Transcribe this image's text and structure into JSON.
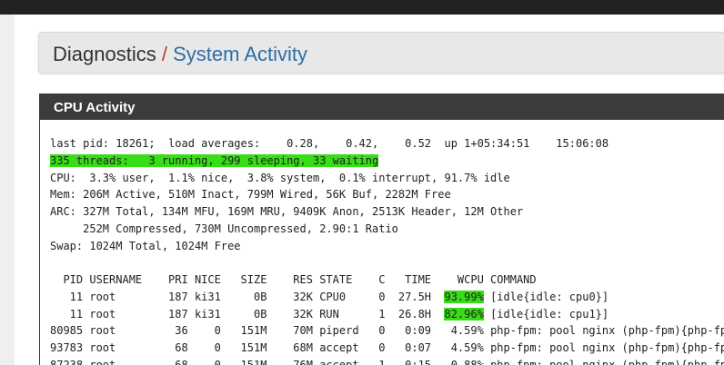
{
  "breadcrumb": {
    "parent": "Diagnostics",
    "separator": "/",
    "current": "System Activity"
  },
  "panel": {
    "title": "CPU Activity"
  },
  "top": {
    "summary_lines": [
      "last pid: 18261;  load averages:    0.28,    0.42,    0.52  up 1+05:34:51    15:06:08",
      "335 threads:   3 running, 299 sleeping, 33 waiting",
      "CPU:  3.3% user,  1.1% nice,  3.8% system,  0.1% interrupt, 91.7% idle",
      "Mem: 206M Active, 510M Inact, 799M Wired, 56K Buf, 2282M Free",
      "ARC: 327M Total, 134M MFU, 169M MRU, 9409K Anon, 2513K Header, 12M Other",
      "     252M Compressed, 730M Uncompressed, 2.90:1 Ratio",
      "Swap: 1024M Total, 1024M Free",
      ""
    ],
    "header": "  PID USERNAME    PRI NICE   SIZE    RES STATE    C   TIME    WCPU COMMAND",
    "rows": [
      {
        "pid": "11",
        "user": "root",
        "pri": "187",
        "nice": "ki31",
        "size": "0B",
        "res": "32K",
        "state": "CPU0",
        "c": "0",
        "time": "27.5H",
        "wcpu": "93.99%",
        "command": "[idle{idle: cpu0}]",
        "highlight": true
      },
      {
        "pid": "11",
        "user": "root",
        "pri": "187",
        "nice": "ki31",
        "size": "0B",
        "res": "32K",
        "state": "RUN",
        "c": "1",
        "time": "26.8H",
        "wcpu": "82.96%",
        "command": "[idle{idle: cpu1}]",
        "highlight": true
      },
      {
        "pid": "80985",
        "user": "root",
        "pri": "36",
        "nice": "0",
        "size": "151M",
        "res": "70M",
        "state": "piperd",
        "c": "0",
        "time": "0:09",
        "wcpu": "4.59%",
        "command": "php-fpm: pool nginx (php-fpm){php-fpm}",
        "highlight": false
      },
      {
        "pid": "93783",
        "user": "root",
        "pri": "68",
        "nice": "0",
        "size": "151M",
        "res": "68M",
        "state": "accept",
        "c": "0",
        "time": "0:07",
        "wcpu": "4.59%",
        "command": "php-fpm: pool nginx (php-fpm){php-fpm}",
        "highlight": false
      },
      {
        "pid": "87238",
        "user": "root",
        "pri": "68",
        "nice": "0",
        "size": "151M",
        "res": "76M",
        "state": "accept",
        "c": "1",
        "time": "0:15",
        "wcpu": "0.88%",
        "command": "php-fpm: pool nginx (php-fpm){php-fpm}",
        "highlight": false
      }
    ]
  },
  "colors": {
    "highlight": "#37dd16",
    "panel_heading": "#3c3c3c",
    "link": "#2c6ea6",
    "separator": "#c0392b"
  }
}
